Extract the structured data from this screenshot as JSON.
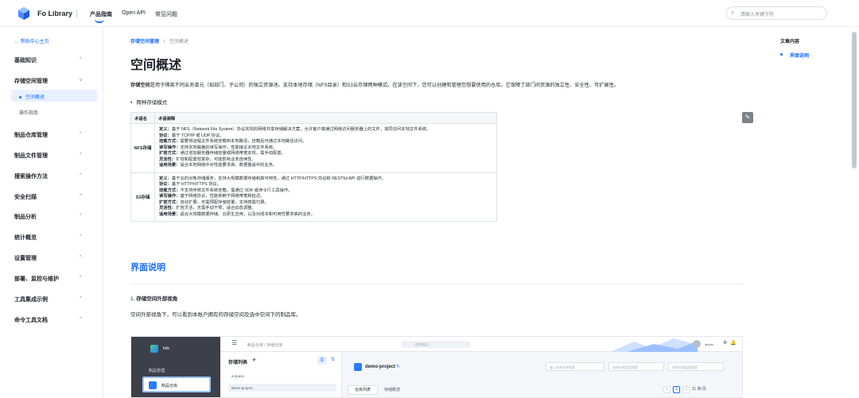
{
  "header": {
    "brand": "Fo Library",
    "nav": [
      "产品指南",
      "Open API",
      "常见问题"
    ],
    "search_placeholder": "请输入关键字符"
  },
  "sidebar": {
    "back": "← 帮助中心主页",
    "sections": [
      {
        "label": "基础知识",
        "chev": "^"
      },
      {
        "label": "存储空间管理",
        "chev": "v",
        "children": [
          "空间概述",
          "操作指南"
        ]
      },
      {
        "label": "制品仓库管理",
        "chev": "^"
      },
      {
        "label": "制品文件管理",
        "chev": "^"
      },
      {
        "label": "搜索操作方法",
        "chev": "^"
      },
      {
        "label": "安全扫描",
        "chev": "^"
      },
      {
        "label": "制品分析",
        "chev": "^"
      },
      {
        "label": "统计概览",
        "chev": "^"
      },
      {
        "label": "设置管理",
        "chev": "^"
      },
      {
        "label": "部署、监控与维护",
        "chev": "^"
      },
      {
        "label": "工具集成示例",
        "chev": "^"
      },
      {
        "label": "命令工具文档",
        "chev": "^"
      }
    ]
  },
  "breadcrumb": {
    "parent": "存储空间管理",
    "sep": "/",
    "current": "空间概述"
  },
  "title": "空间概述",
  "intro": {
    "term": "存储空间",
    "text": "是用于隔离不同业务单元（如部门、子公司）的独立资源池。支持本地存储（NFS目录）和S3云存储两种模式。在该空间下，您可以创建和管理您想要使用的仓库。它保障了部门间资源的独立性、安全性、可扩展性。"
  },
  "bullet": "两种存储模式",
  "table": {
    "headers": [
      "术语名",
      "术语阐释"
    ],
    "rows": [
      {
        "term": "NFS存储",
        "lines": [
          {
            "k": "定义：",
            "v": "基于 NFS（Network File System）协议实现的网络共享存储解决方案，允许客户端通过网络访问服务器上的文件，如同访问本地文件系统。"
          },
          {
            "k": "协议：",
            "v": "基于 TCP/IP 或 UDP 协议。"
          },
          {
            "k": "挂载方式：",
            "v": "需要将远程文件系统挂载到本地路径，挂载后可通过本地路径访问。"
          },
          {
            "k": "读写操作：",
            "v": "支持本地磁盘的读写操作，性能接近本地文件系统。"
          },
          {
            "k": "扩容方式：",
            "v": "通过增加服务器存储容量或网络带宽实现，需手动配置。"
          },
          {
            "k": "灵活性：",
            "v": "扩容和配置较复杂，可能影响业务连续性。"
          },
          {
            "k": "适用场景：",
            "v": "适合本地网络中对性能要求高、数据量适中的业务。"
          }
        ]
      },
      {
        "term": "S3存储",
        "lines": [
          {
            "k": "定义：",
            "v": "基于云的对象存储服务，支持大规模数据存储和高可用性，通过 HTTP/HTTPS 协议和 RESTful API 进行数据操作。"
          },
          {
            "k": "协议：",
            "v": "基于 HTTP/HTTPS 协议。"
          },
          {
            "k": "挂载方式：",
            "v": "不支持传统文件系统挂载，需通过 SDK 或命令行工具操作。"
          },
          {
            "k": "读写操作：",
            "v": "基于网络协议，性能依赖于网络带宽和延迟。"
          },
          {
            "k": "扩容方式：",
            "v": "自动扩展，无需预配存储容量，支持按需付费。"
          },
          {
            "k": "灵活性：",
            "v": "扩容灵活，无需手动干预，适合动态调整。"
          },
          {
            "k": "适用场景：",
            "v": "适合大规模数据存储、云原生应用，以及对成本和可用性要求高的业务。"
          }
        ]
      }
    ]
  },
  "section2": {
    "title": "界面说明",
    "sub_num": "1. ",
    "sub_title": "存储空间外部视角",
    "desc": "空间外部视角下，可以看到本账户拥有的存储空间及选中空间下的制品库。"
  },
  "screenshot": {
    "brand": "foib",
    "sidebar_label": "制品管理",
    "sidebar_btn": "制品仓库",
    "crumb": "制品仓库  /  存储仓库",
    "search": "搜索制品...",
    "admin": "admin",
    "list_title": "存储列表",
    "list_items": [
      "a-space",
      "demo-project"
    ],
    "project": "demo-project",
    "select1": "输入仓库名称搜索",
    "select2": "选择仓库类型搜索",
    "select3": "选择存储类型搜索",
    "tab1": "仓库列表",
    "tab2": "存储概述",
    "page": "1",
    "total": "11 条/页"
  },
  "toc": {
    "title": "文章内容",
    "items": [
      "界面说明"
    ]
  },
  "colors": {
    "accent": "#1e6fff",
    "active_bg": "#e8f0ff"
  }
}
